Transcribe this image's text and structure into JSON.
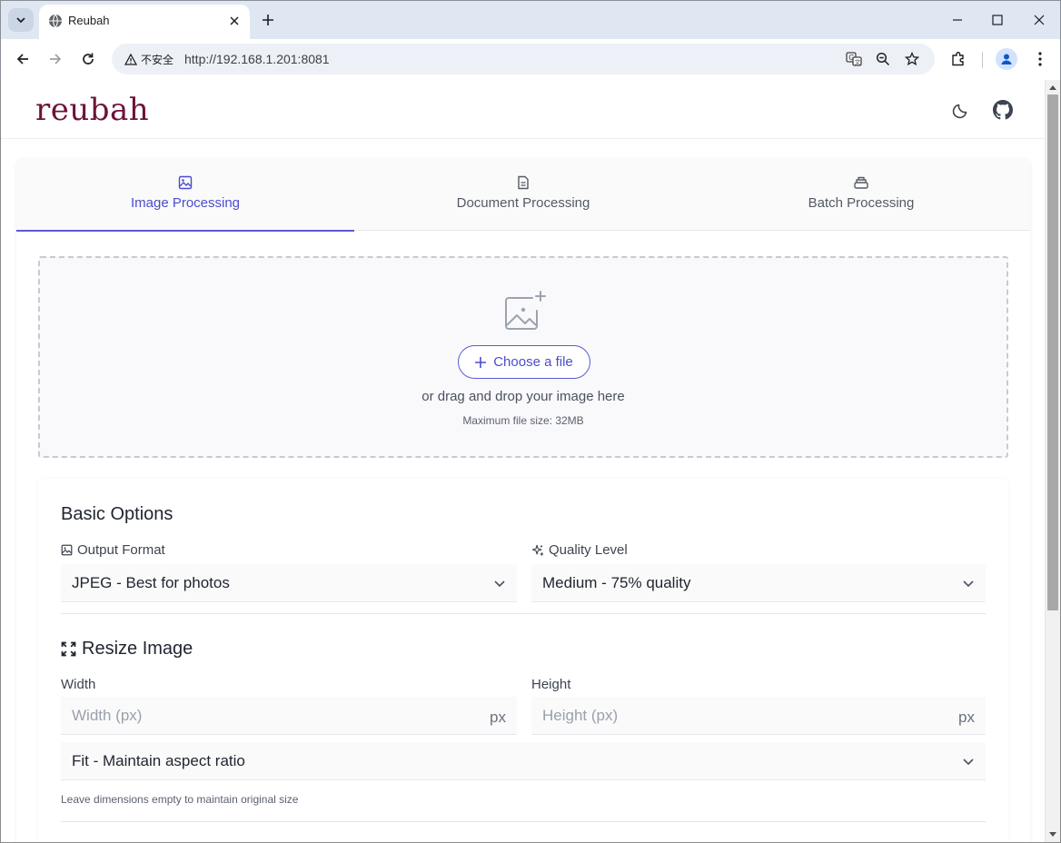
{
  "browser": {
    "tab_title": "Reubah",
    "security_label": "不安全",
    "url": "http://192.168.1.201:8081"
  },
  "app": {
    "logo_text": "reubah",
    "brand_color": "#6e1239",
    "accent_color": "#5b5bd6"
  },
  "tabs": [
    {
      "label": "Image Processing",
      "icon": "image-icon",
      "active": true
    },
    {
      "label": "Document Processing",
      "icon": "document-icon",
      "active": false
    },
    {
      "label": "Batch Processing",
      "icon": "stack-icon",
      "active": false
    }
  ],
  "upload": {
    "button_label": "Choose a file",
    "drag_text": "or drag and drop your image here",
    "max_size_text": "Maximum file size: 32MB"
  },
  "basic_options": {
    "title": "Basic Options",
    "output_format_label": "Output Format",
    "output_format_value": "JPEG - Best for photos",
    "quality_label": "Quality Level",
    "quality_value": "Medium - 75% quality"
  },
  "resize": {
    "title": "Resize Image",
    "width_label": "Width",
    "width_placeholder": "Width (px)",
    "height_label": "Height",
    "height_placeholder": "Height (px)",
    "unit": "px",
    "fit_value": "Fit - Maintain aspect ratio",
    "hint": "Leave dimensions empty to maintain original size"
  }
}
